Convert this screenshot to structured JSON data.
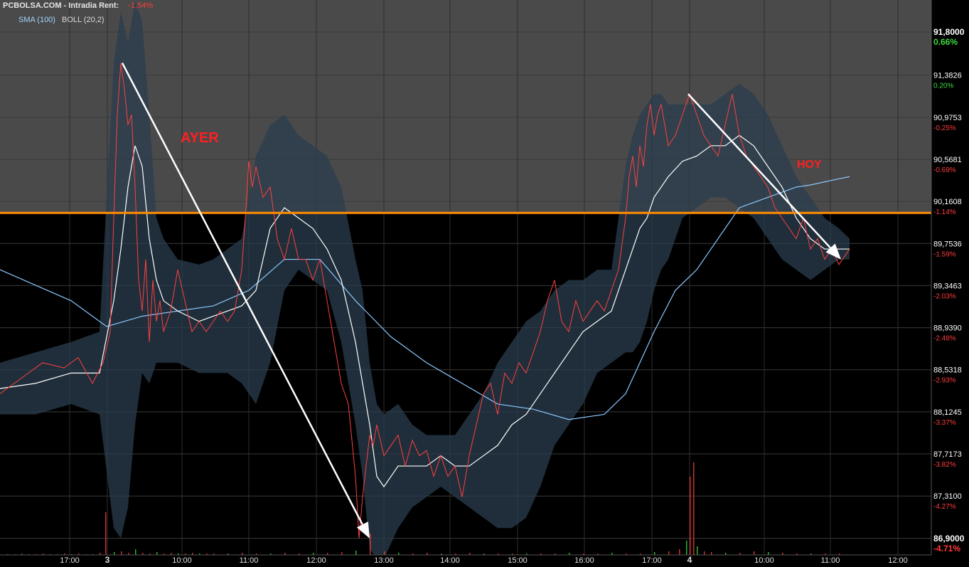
{
  "header": {
    "site": "PCBOLSA.COM - Intradia",
    "rent_label": "Rent:",
    "rent_value": "-1,54%"
  },
  "indicators": {
    "sma": "SMA (100)",
    "boll": "BOLL (20,2)"
  },
  "annotations": {
    "ayer": "AYER",
    "hoy": "HOY"
  },
  "colors": {
    "background": "#000000",
    "upper_zone": "#4a4a4a",
    "price_line": "#ff4040",
    "bollinger_band": "#2a3d4d",
    "bollinger_mid": "#ffffff",
    "sma": "#8cc8ff",
    "reference_line": "#ff8c00",
    "arrows": "#ffffff",
    "annotation_text": "#ff2020",
    "pct_positive": "#3ddc3d",
    "pct_negative": "#ff3b3b"
  },
  "chart_data": {
    "type": "line",
    "title": "",
    "xlabel": "",
    "ylabel": "",
    "ylim": [
      86.74,
      92.11
    ],
    "x_ticks": [
      "17:00",
      "3",
      "10:00",
      "11:00",
      "12:00",
      "13:00",
      "14:00",
      "15:00",
      "16:00",
      "17:00",
      "4",
      "10:00",
      "11:00",
      "12:00"
    ],
    "y_ticks": [
      {
        "value": 91.8,
        "label": "91,8000",
        "pct": "0.66%"
      },
      {
        "value": 91.3826,
        "label": "91,3826",
        "pct": "0.20%"
      },
      {
        "value": 90.9753,
        "label": "90,9753",
        "pct": "-0.25%"
      },
      {
        "value": 90.5681,
        "label": "90,5681",
        "pct": "-0.69%"
      },
      {
        "value": 90.1608,
        "label": "90,1608",
        "pct": "-1.14%"
      },
      {
        "value": 89.7536,
        "label": "89,7536",
        "pct": "-1.59%"
      },
      {
        "value": 89.3463,
        "label": "89,3463",
        "pct": "-2.03%"
      },
      {
        "value": 88.939,
        "label": "88,9390",
        "pct": "-2.48%"
      },
      {
        "value": 88.5318,
        "label": "88,5318",
        "pct": "-2.93%"
      },
      {
        "value": 88.1245,
        "label": "88,1245",
        "pct": "-3.37%"
      },
      {
        "value": 87.7173,
        "label": "87,7173",
        "pct": "-3.82%"
      },
      {
        "value": 87.31,
        "label": "87,3100",
        "pct": "-4.27%"
      },
      {
        "value": 86.9,
        "label": "86,9000",
        "pct": "-4.71%"
      }
    ],
    "reference_line": 90.05,
    "series": [
      {
        "style": "price",
        "x": [
          0,
          30,
          60,
          90,
          110,
          130,
          145,
          155,
          160,
          165,
          170,
          175,
          180,
          185,
          190,
          195,
          200,
          205,
          210,
          215,
          220,
          225,
          230,
          240,
          250,
          260,
          270,
          280,
          290,
          300,
          310,
          320,
          330,
          340,
          345,
          350,
          355,
          360,
          370,
          380,
          390,
          400,
          410,
          420,
          430,
          440,
          450,
          460,
          470,
          480,
          490,
          500,
          505,
          510,
          515,
          520,
          525,
          530,
          540,
          550,
          560,
          570,
          580,
          590,
          600,
          610,
          620,
          630,
          640,
          650,
          660,
          670,
          680,
          690,
          700,
          710,
          720,
          730,
          740,
          750,
          760,
          770,
          780,
          790,
          800,
          810,
          820,
          830,
          840,
          850,
          860,
          870,
          880,
          885,
          890,
          895,
          900,
          905,
          910,
          915,
          920,
          925,
          930,
          935,
          940,
          950,
          960,
          970,
          980,
          990,
          1000,
          1010,
          1020,
          1030,
          1040,
          1050,
          1060,
          1070,
          1080,
          1090,
          1100,
          1110,
          1120,
          1130,
          1140,
          1150,
          1160,
          1170,
          1180,
          1195
        ],
        "y": [
          88.3,
          88.45,
          88.6,
          88.55,
          88.65,
          88.4,
          88.6,
          88.9,
          90.0,
          91.0,
          91.5,
          91.25,
          90.9,
          91.0,
          90.3,
          89.4,
          89.1,
          89.6,
          88.8,
          89.4,
          89.0,
          89.2,
          88.9,
          89.1,
          89.5,
          89.2,
          88.9,
          89.0,
          88.9,
          89.0,
          89.1,
          89.0,
          89.1,
          89.5,
          90.0,
          90.55,
          90.3,
          90.5,
          90.2,
          90.3,
          89.8,
          89.6,
          89.9,
          89.6,
          89.6,
          89.4,
          89.6,
          89.2,
          88.8,
          88.4,
          88.2,
          87.5,
          86.9,
          87.3,
          87.6,
          87.9,
          87.8,
          88.0,
          87.7,
          87.8,
          87.9,
          87.6,
          87.85,
          87.7,
          87.75,
          87.5,
          87.7,
          87.5,
          87.6,
          87.3,
          87.7,
          88.0,
          88.3,
          88.4,
          88.1,
          88.5,
          88.4,
          88.6,
          88.5,
          88.7,
          88.9,
          89.2,
          89.4,
          89.0,
          88.9,
          89.2,
          89.0,
          89.1,
          89.2,
          89.1,
          89.3,
          89.5,
          90.0,
          90.4,
          90.6,
          90.3,
          90.7,
          90.5,
          90.9,
          91.1,
          90.8,
          91.0,
          91.1,
          90.9,
          90.7,
          90.8,
          91.0,
          91.2,
          91.0,
          90.8,
          90.7,
          90.6,
          90.9,
          91.2,
          90.8,
          90.6,
          90.5,
          90.4,
          90.3,
          90.1,
          90.0,
          89.9,
          89.8,
          90.0,
          89.7,
          89.8,
          89.6,
          89.7,
          89.55,
          89.7
        ]
      },
      {
        "style": "bollinger_upper",
        "x": [
          0,
          50,
          100,
          140,
          160,
          170,
          180,
          190,
          200,
          210,
          220,
          230,
          250,
          280,
          300,
          320,
          340,
          360,
          380,
          400,
          420,
          440,
          460,
          480,
          500,
          510,
          520,
          530,
          540,
          560,
          580,
          600,
          620,
          640,
          660,
          680,
          700,
          720,
          740,
          760,
          780,
          800,
          820,
          840,
          860,
          880,
          890,
          900,
          910,
          920,
          930,
          940,
          960,
          980,
          1000,
          1020,
          1040,
          1060,
          1080,
          1100,
          1120,
          1140,
          1160,
          1180,
          1195
        ],
        "y": [
          88.6,
          88.7,
          88.8,
          88.9,
          91.5,
          92.0,
          91.7,
          92.1,
          91.9,
          91.0,
          90.0,
          89.8,
          89.6,
          89.55,
          89.6,
          89.7,
          89.8,
          90.6,
          90.9,
          91.0,
          90.8,
          90.7,
          90.6,
          90.3,
          89.6,
          89.3,
          88.6,
          88.2,
          88.1,
          88.2,
          88.0,
          87.9,
          87.9,
          87.9,
          88.1,
          88.3,
          88.6,
          88.8,
          89.0,
          89.1,
          89.3,
          89.4,
          89.4,
          89.5,
          89.5,
          90.5,
          90.8,
          91.0,
          91.1,
          91.2,
          91.2,
          91.1,
          91.1,
          91.1,
          91.1,
          91.2,
          91.3,
          91.2,
          91.0,
          90.7,
          90.4,
          90.2,
          90.0,
          89.9,
          89.8
        ]
      },
      {
        "style": "bollinger_lower",
        "x": [
          0,
          50,
          100,
          140,
          160,
          170,
          180,
          190,
          200,
          210,
          220,
          230,
          250,
          280,
          300,
          320,
          340,
          360,
          380,
          400,
          420,
          440,
          460,
          480,
          500,
          510,
          520,
          530,
          540,
          560,
          580,
          600,
          620,
          640,
          660,
          680,
          700,
          720,
          740,
          760,
          780,
          800,
          820,
          840,
          860,
          880,
          890,
          900,
          910,
          920,
          930,
          940,
          960,
          980,
          1000,
          1020,
          1040,
          1060,
          1080,
          1100,
          1120,
          1140,
          1160,
          1180,
          1195
        ],
        "y": [
          88.1,
          88.1,
          88.2,
          88.1,
          87.0,
          86.9,
          87.2,
          88.0,
          88.5,
          88.4,
          88.6,
          88.6,
          88.6,
          88.5,
          88.5,
          88.5,
          88.4,
          88.2,
          88.6,
          89.3,
          89.5,
          89.4,
          89.3,
          88.8,
          88.0,
          87.5,
          86.8,
          86.7,
          86.7,
          87.0,
          87.2,
          87.3,
          87.4,
          87.3,
          87.2,
          87.1,
          87.0,
          87.0,
          87.1,
          87.4,
          87.8,
          88.0,
          88.2,
          88.5,
          88.6,
          88.7,
          88.7,
          88.8,
          89.0,
          89.3,
          89.5,
          89.6,
          90.0,
          90.1,
          90.2,
          90.2,
          90.1,
          90.0,
          89.8,
          89.6,
          89.5,
          89.4,
          89.5,
          89.6,
          89.6
        ]
      },
      {
        "style": "bollinger_mid",
        "x": [
          0,
          50,
          100,
          140,
          160,
          170,
          180,
          190,
          200,
          210,
          220,
          230,
          250,
          280,
          300,
          320,
          340,
          360,
          380,
          400,
          420,
          440,
          460,
          480,
          500,
          510,
          520,
          530,
          540,
          560,
          580,
          600,
          620,
          640,
          660,
          680,
          700,
          720,
          740,
          760,
          780,
          800,
          820,
          840,
          860,
          880,
          890,
          900,
          910,
          920,
          930,
          940,
          960,
          980,
          1000,
          1020,
          1040,
          1060,
          1080,
          1100,
          1120,
          1140,
          1160,
          1180,
          1195
        ],
        "y": [
          88.35,
          88.4,
          88.5,
          88.5,
          89.2,
          89.7,
          90.3,
          90.7,
          90.5,
          89.8,
          89.4,
          89.2,
          89.1,
          89.0,
          89.05,
          89.1,
          89.15,
          89.3,
          89.9,
          90.1,
          90.0,
          89.9,
          89.7,
          89.4,
          88.8,
          88.4,
          88.0,
          87.5,
          87.4,
          87.6,
          87.6,
          87.6,
          87.7,
          87.6,
          87.6,
          87.7,
          87.8,
          88.0,
          88.1,
          88.3,
          88.5,
          88.7,
          88.9,
          89.0,
          89.1,
          89.5,
          89.7,
          89.9,
          90.0,
          90.2,
          90.3,
          90.4,
          90.55,
          90.6,
          90.7,
          90.7,
          90.8,
          90.7,
          90.5,
          90.3,
          90.0,
          89.8,
          89.7,
          89.7,
          89.7
        ]
      },
      {
        "style": "sma",
        "x": [
          0,
          50,
          100,
          150,
          200,
          250,
          300,
          350,
          400,
          450,
          500,
          550,
          600,
          650,
          700,
          750,
          800,
          850,
          880,
          900,
          920,
          950,
          980,
          1000,
          1020,
          1040,
          1060,
          1080,
          1100,
          1120,
          1140,
          1160,
          1180,
          1195
        ],
        "y": [
          89.5,
          89.35,
          89.2,
          88.95,
          89.05,
          89.1,
          89.15,
          89.3,
          89.6,
          89.6,
          89.2,
          88.85,
          88.6,
          88.4,
          88.2,
          88.15,
          88.05,
          88.1,
          88.3,
          88.6,
          88.9,
          89.3,
          89.5,
          89.7,
          89.9,
          90.1,
          90.15,
          90.2,
          90.25,
          90.3,
          90.32,
          90.35,
          90.38,
          90.4
        ]
      }
    ],
    "arrows": [
      {
        "x1": 172,
        "y1": 91.5,
        "x2": 520,
        "y2": 86.9
      },
      {
        "x1": 968,
        "y1": 91.2,
        "x2": 1183,
        "y2": 89.6
      }
    ],
    "volume": {
      "x": [
        10,
        20,
        30,
        40,
        50,
        60,
        70,
        80,
        90,
        100,
        110,
        120,
        130,
        140,
        148,
        160,
        170,
        180,
        190,
        200,
        210,
        220,
        230,
        240,
        250,
        260,
        270,
        280,
        290,
        300,
        320,
        340,
        360,
        380,
        400,
        420,
        440,
        460,
        480,
        500,
        520,
        540,
        560,
        580,
        600,
        620,
        640,
        660,
        680,
        700,
        720,
        740,
        760,
        780,
        800,
        820,
        840,
        860,
        880,
        900,
        920,
        940,
        955,
        965,
        970,
        975,
        980,
        990,
        1000,
        1020,
        1040,
        1060,
        1080,
        1100,
        1120,
        1140,
        1160,
        1180
      ],
      "y": [
        1,
        1,
        2,
        1,
        1,
        2,
        1,
        1,
        2,
        1,
        2,
        1,
        1,
        3,
        60,
        4,
        5,
        3,
        8,
        3,
        2,
        4,
        2,
        3,
        2,
        2,
        3,
        2,
        2,
        2,
        2,
        3,
        2,
        2,
        3,
        2,
        3,
        3,
        4,
        6,
        30,
        5,
        3,
        2,
        3,
        2,
        2,
        3,
        2,
        2,
        2,
        2,
        2,
        2,
        3,
        2,
        2,
        3,
        2,
        2,
        4,
        5,
        8,
        20,
        110,
        130,
        12,
        5,
        4,
        3,
        3,
        5,
        4,
        3,
        2,
        2,
        2,
        2
      ]
    }
  }
}
